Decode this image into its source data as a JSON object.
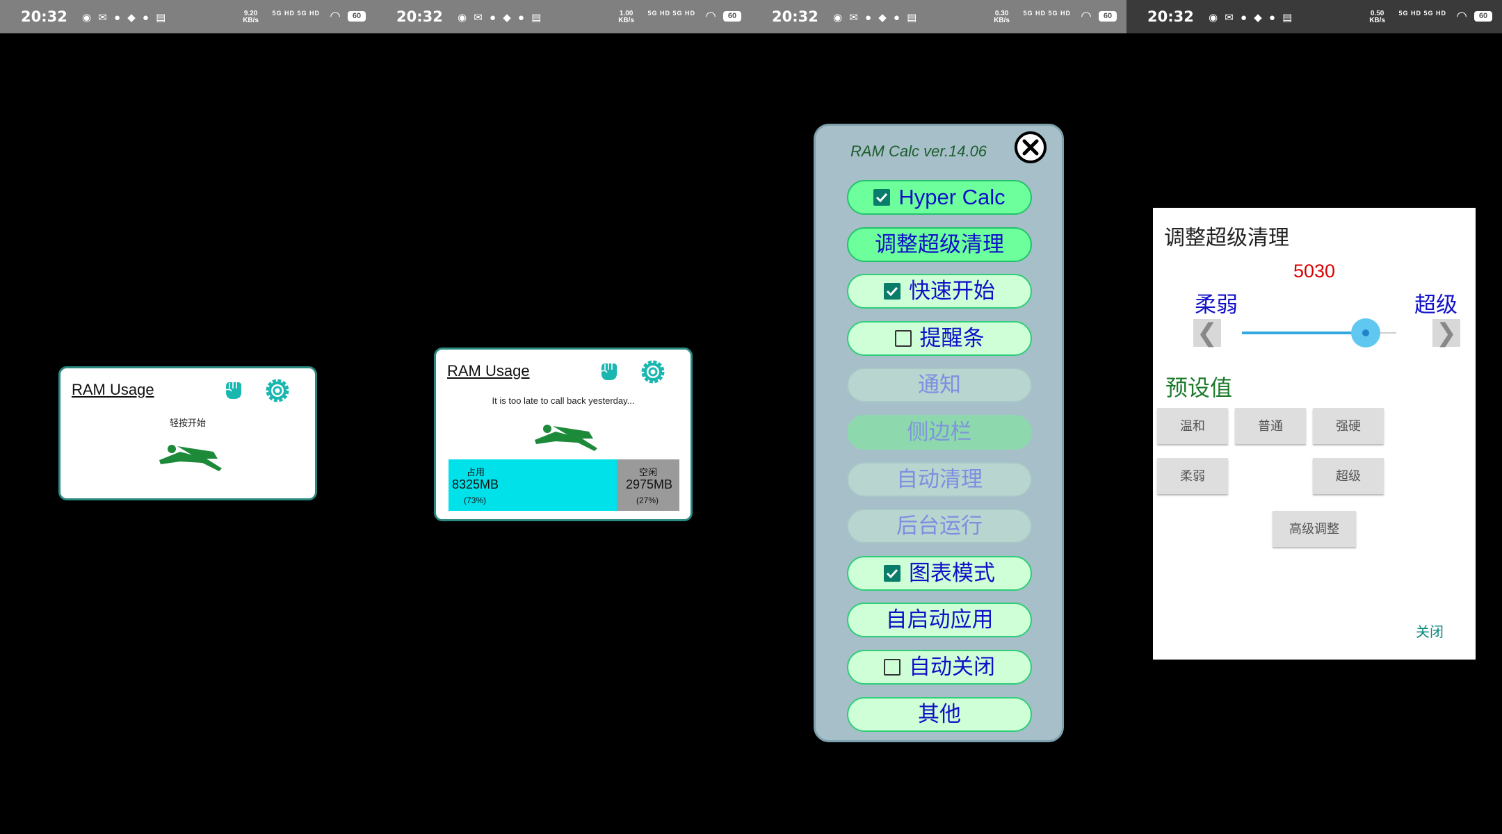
{
  "statusbar": {
    "time": "20:32",
    "icons": "◉ ✉ ● ◆ ● ▤",
    "net": "5G HD 5G HD",
    "battery": "60",
    "speed_unit": "KB/s",
    "speeds": [
      "9.20",
      "1.00",
      "0.30",
      "0.50"
    ]
  },
  "widget1": {
    "title": "RAM Usage",
    "hint": "轻按开始"
  },
  "widget2": {
    "title": "RAM Usage",
    "message": "It is too late to call back yesterday...",
    "used_label": "占用",
    "used_mb": "8325MB",
    "used_pct": "(73%)",
    "used_fraction": 0.73,
    "free_label": "空闲",
    "free_mb": "2975MB",
    "free_pct": "(27%)"
  },
  "menu": {
    "title": "RAM Calc ver.14.06",
    "items": [
      {
        "label": "Hyper Calc",
        "check": "on",
        "state": "active"
      },
      {
        "label": "调整超级清理",
        "check": "none",
        "state": "active"
      },
      {
        "label": "快速开始",
        "check": "on",
        "state": "normal"
      },
      {
        "label": "提醒条",
        "check": "off",
        "state": "normal"
      },
      {
        "label": "通知",
        "check": "none",
        "state": "disabled"
      },
      {
        "label": "侧边栏",
        "check": "none",
        "state": "side"
      },
      {
        "label": "自动清理",
        "check": "none",
        "state": "disabled"
      },
      {
        "label": "后台运行",
        "check": "none",
        "state": "disabled"
      },
      {
        "label": "图表模式",
        "check": "on",
        "state": "normal"
      },
      {
        "label": "自启动应用",
        "check": "none",
        "state": "normal"
      },
      {
        "label": "自动关闭",
        "check": "off",
        "state": "normal"
      },
      {
        "label": "其他",
        "check": "none",
        "state": "normal"
      }
    ]
  },
  "dialog": {
    "title": "调整超级清理",
    "value": "5030",
    "weak_label": "柔弱",
    "super_label": "超级",
    "slider_fraction": 0.8,
    "left_arrow": "❮",
    "right_arrow": "❯",
    "preset_title": "预设值",
    "presets": [
      "温和",
      "普通",
      "强硬",
      "柔弱",
      "超级"
    ],
    "advanced": "高级调整",
    "close": "关闭"
  }
}
